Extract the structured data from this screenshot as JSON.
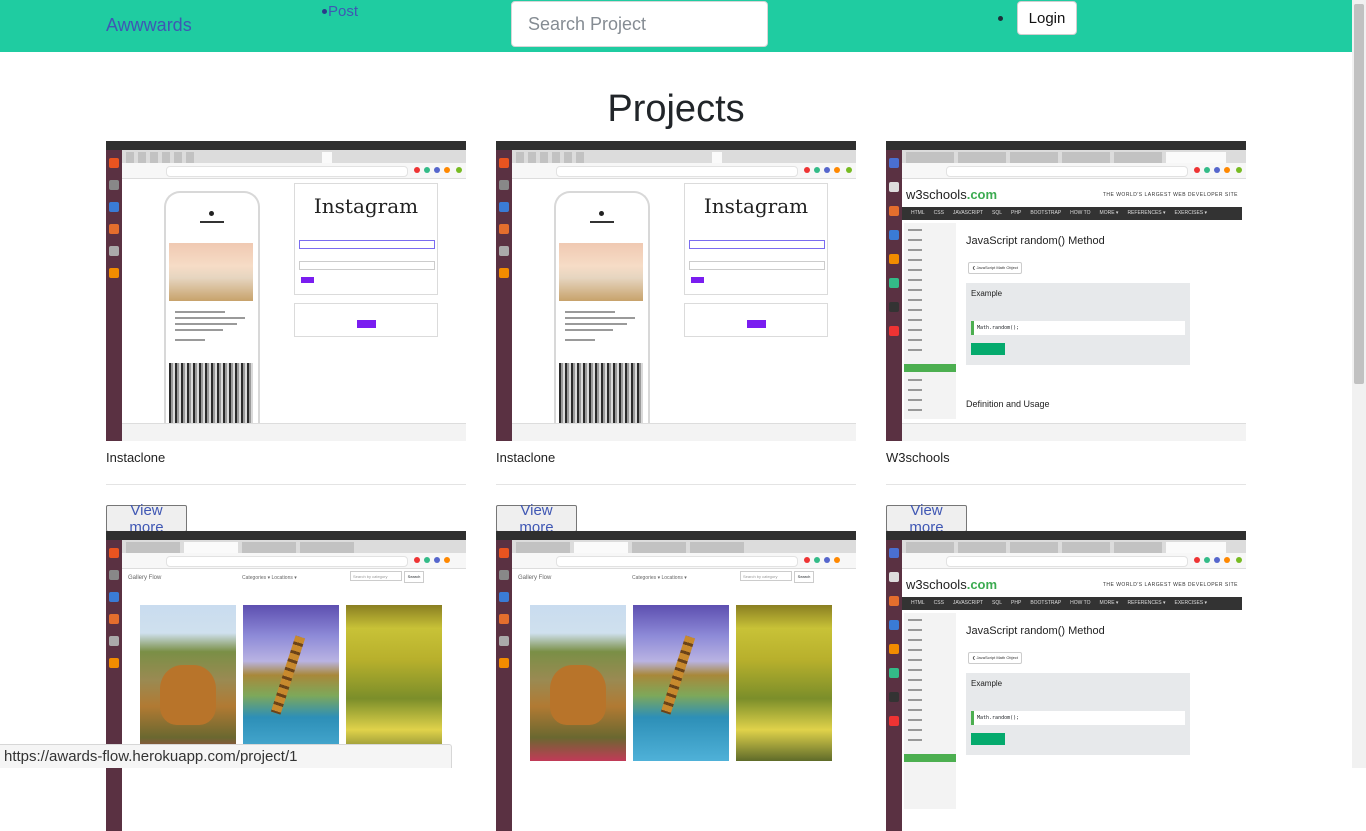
{
  "navbar": {
    "brand": "Awwwards",
    "post_link": "Post",
    "search_placeholder": "Search Project",
    "login_label": "Login"
  },
  "page_title": "Projects",
  "cards": [
    {
      "name": "Instaclone",
      "view_more": "View more"
    },
    {
      "name": "Instaclone",
      "view_more": "View more"
    },
    {
      "name": "W3schools",
      "view_more": "View more"
    },
    {
      "name": "",
      "view_more": ""
    },
    {
      "name": "",
      "view_more": ""
    },
    {
      "name": "",
      "view_more": ""
    }
  ],
  "thumbs": {
    "instagram_logo": "Instagram",
    "w3_logo_prefix": "w3schools",
    "w3_logo_suffix": ".com",
    "w3_tagline": "THE WORLD'S LARGEST WEB DEVELOPER SITE",
    "w3_menu": [
      "HTML",
      "CSS",
      "JAVASCRIPT",
      "SQL",
      "PHP",
      "BOOTSTRAP",
      "HOW TO",
      "MORE ▾",
      "REFERENCES ▾",
      "EXERCISES ▾"
    ],
    "w3_heading": "JavaScript random() Method",
    "w3_prev": "❮ JavaScript Math Object",
    "w3_example": "Example",
    "w3_code": "Math.random();",
    "w3_def": "Definition and Usage",
    "gallery_title": "Gallery Flow",
    "gallery_menu": "Categories ▾    Locations ▾",
    "gallery_search": "Search by category",
    "gallery_search_btn": "Search"
  },
  "status_url": "https://awards-flow.herokuapp.com/project/1",
  "colors": {
    "navbar": "#1fcca1",
    "link": "#3f57b4"
  }
}
